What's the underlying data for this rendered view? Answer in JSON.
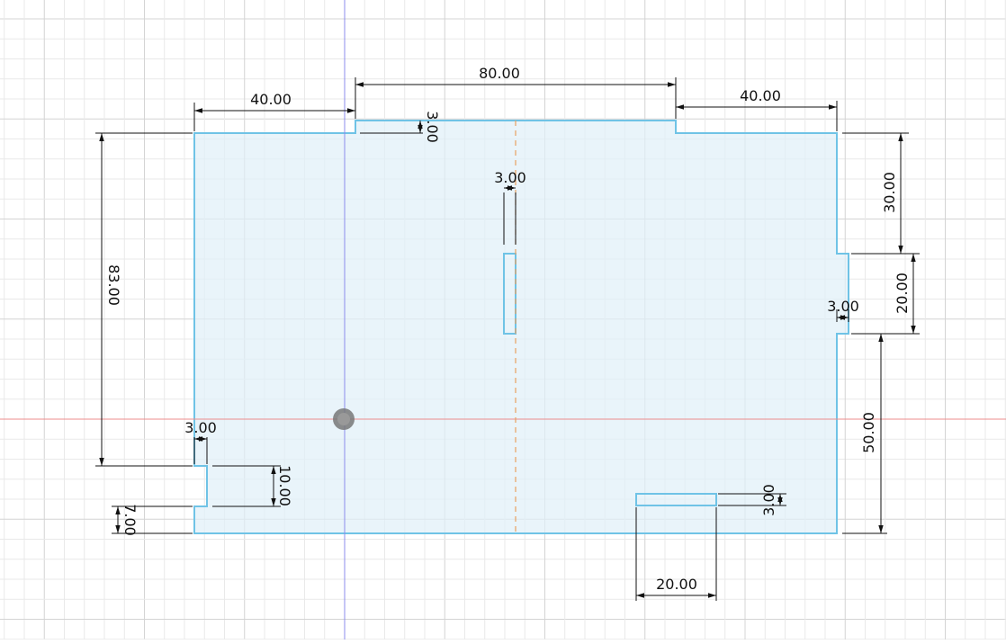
{
  "sketch": {
    "dimensions": {
      "top_left_width": "40.00",
      "top_center_width": "80.00",
      "top_right_width": "40.00",
      "top_notch_depth": "3.00",
      "center_slot_width": "3.00",
      "left_height": "83.00",
      "right_top_offset": "30.00",
      "right_notch_height": "20.00",
      "right_notch_depth": "3.00",
      "right_bottom_offset": "50.00",
      "left_notch_depth": "3.00",
      "left_notch_height": "10.00",
      "left_bottom_offset": "7.00",
      "bottom_slot_height": "3.00",
      "bottom_slot_width": "20.00"
    },
    "colors": {
      "sketch_line": "#6fc3e6",
      "fill": "#dff0f8",
      "x_axis": "#ec8c8c",
      "y_axis": "#8c8cec",
      "centerline": "#e8a060",
      "origin_point": "#777777"
    },
    "origin_icon": "origin-point-icon"
  }
}
